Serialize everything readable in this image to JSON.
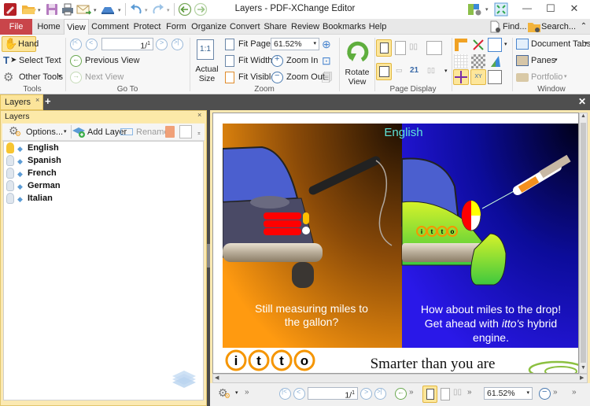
{
  "window": {
    "title": "Layers - PDF-XChange Editor",
    "controls": {
      "minimize": "—",
      "maximize": "☐",
      "close": "✕"
    }
  },
  "quick_access": [
    "app-icon",
    "open-icon",
    "save-icon",
    "print-icon",
    "email-icon",
    "scan-icon",
    "undo-icon",
    "redo-icon",
    "back-icon",
    "forward-icon"
  ],
  "menu": {
    "items": [
      "File",
      "Home",
      "View",
      "Comment",
      "Protect",
      "Form",
      "Organize",
      "Convert",
      "Share",
      "Review",
      "Bookmarks",
      "Help"
    ],
    "active": "View",
    "find": "Find...",
    "search": "Search..."
  },
  "ribbon": {
    "tools": {
      "label": "Tools",
      "hand": "Hand",
      "select_text": "Select Text",
      "other_tools": "Other Tools"
    },
    "goto": {
      "label": "Go To",
      "page_value": "1/",
      "page_total": "1",
      "previous_view": "Previous View",
      "next_view": "Next View"
    },
    "zoom": {
      "label": "Zoom",
      "actual_size_1": "Actual",
      "actual_size_2": "Size",
      "actual_icon": "1:1",
      "fit_page": "Fit Page",
      "fit_width": "Fit Width",
      "fit_visible": "Fit Visible",
      "zoom_value": "61.52%",
      "zoom_in": "Zoom In",
      "zoom_out": "Zoom Out"
    },
    "rotate": {
      "label1": "Rotate",
      "label2": "View"
    },
    "page_display": {
      "label": "Page Display"
    },
    "window": {
      "label": "Window",
      "document_tabs": "Document Tabs",
      "panes": "Panes",
      "portfolio": "Portfolio"
    }
  },
  "tabs": {
    "layers_tab": "Layers",
    "close": "×",
    "add": "+"
  },
  "layers_pane": {
    "title": "Layers",
    "close": "×",
    "options": "Options...",
    "add_layer": "Add Layer",
    "rename": "Rename",
    "layers": [
      {
        "name": "English",
        "visible": true
      },
      {
        "name": "Spanish",
        "visible": false
      },
      {
        "name": "French",
        "visible": false
      },
      {
        "name": "German",
        "visible": false
      },
      {
        "name": "Italian",
        "visible": false
      }
    ]
  },
  "document": {
    "layer_label": "English",
    "caption_left_1": "Still measuring miles to",
    "caption_left_2": "the gallon?",
    "caption_right_1": "How about miles to the drop!",
    "caption_right_2a": "Get ahead with ",
    "caption_right_2b": "itto's",
    "caption_right_2c": " hybrid",
    "caption_right_3": "engine.",
    "logo_letters": [
      "i",
      "t",
      "t",
      "o"
    ],
    "slogan": "Smarter than you are"
  },
  "statusbar": {
    "page_value": "1/",
    "page_total": "1",
    "zoom_value": "61.52%"
  }
}
